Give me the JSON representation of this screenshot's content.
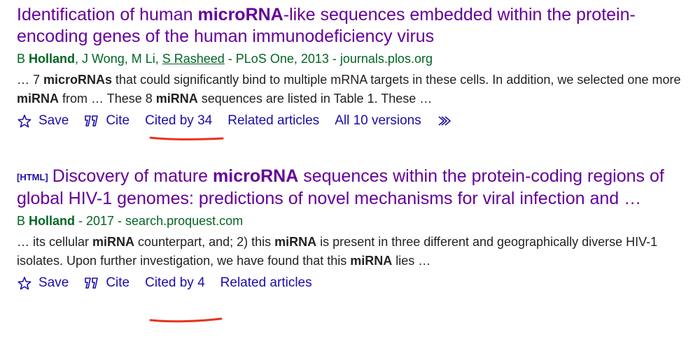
{
  "results": [
    {
      "tag": "",
      "title_parts": [
        {
          "t": "Identification of human ",
          "b": false
        },
        {
          "t": "microRNA",
          "b": true
        },
        {
          "t": "-like sequences embedded within the protein-encoding genes of the human immunodeficiency virus",
          "b": false
        }
      ],
      "author_parts": [
        {
          "t": "B ",
          "b": false,
          "u": false
        },
        {
          "t": "Holland",
          "b": true,
          "u": false
        },
        {
          "t": ", J Wong, M Li, ",
          "b": false,
          "u": false
        },
        {
          "t": "S Rasheed",
          "b": false,
          "u": true
        },
        {
          "t": " - PLoS One, 2013 - journals.plos.org",
          "b": false,
          "u": false
        }
      ],
      "snippet_parts": [
        {
          "t": "… 7 ",
          "b": false
        },
        {
          "t": "microRNAs",
          "b": true
        },
        {
          "t": " that could significantly bind to multiple mRNA targets in these cells. In addition, we selected one more ",
          "b": false
        },
        {
          "t": "miRNA",
          "b": true
        },
        {
          "t": " from … These 8 ",
          "b": false
        },
        {
          "t": "miRNA",
          "b": true
        },
        {
          "t": " sequences are listed in Table 1. These …",
          "b": false
        }
      ],
      "actions": {
        "save": "Save",
        "cite": "Cite",
        "cited_by": "Cited by 34",
        "related": "Related articles",
        "versions": "All 10 versions"
      }
    },
    {
      "tag": "[HTML]",
      "title_parts": [
        {
          "t": "Discovery of mature ",
          "b": false
        },
        {
          "t": "microRNA",
          "b": true
        },
        {
          "t": " sequences within the protein-coding regions of global HIV-1 genomes: predictions of novel mechanisms for viral infection and …",
          "b": false
        }
      ],
      "author_parts": [
        {
          "t": "B ",
          "b": false,
          "u": false
        },
        {
          "t": "Holland",
          "b": true,
          "u": false
        },
        {
          "t": " - 2017 - search.proquest.com",
          "b": false,
          "u": false
        }
      ],
      "snippet_parts": [
        {
          "t": "… its cellular ",
          "b": false
        },
        {
          "t": "miRNA",
          "b": true
        },
        {
          "t": " counterpart, and; 2) this ",
          "b": false
        },
        {
          "t": "miRNA",
          "b": true
        },
        {
          "t": " is present in three different and geographically diverse HIV-1 isolates. Upon further investigation, we have found that this ",
          "b": false
        },
        {
          "t": "miRNA",
          "b": true
        },
        {
          "t": " lies …",
          "b": false
        }
      ],
      "actions": {
        "save": "Save",
        "cite": "Cite",
        "cited_by": "Cited by 4",
        "related": "Related articles"
      }
    }
  ],
  "colors": {
    "title": "#660099",
    "authors": "#006621",
    "links": "#1a0dab",
    "annotation": "#e8341c"
  },
  "icons": {
    "save": "star-outline-icon",
    "cite": "quote-icon",
    "more": "double-chevron-right-icon"
  }
}
